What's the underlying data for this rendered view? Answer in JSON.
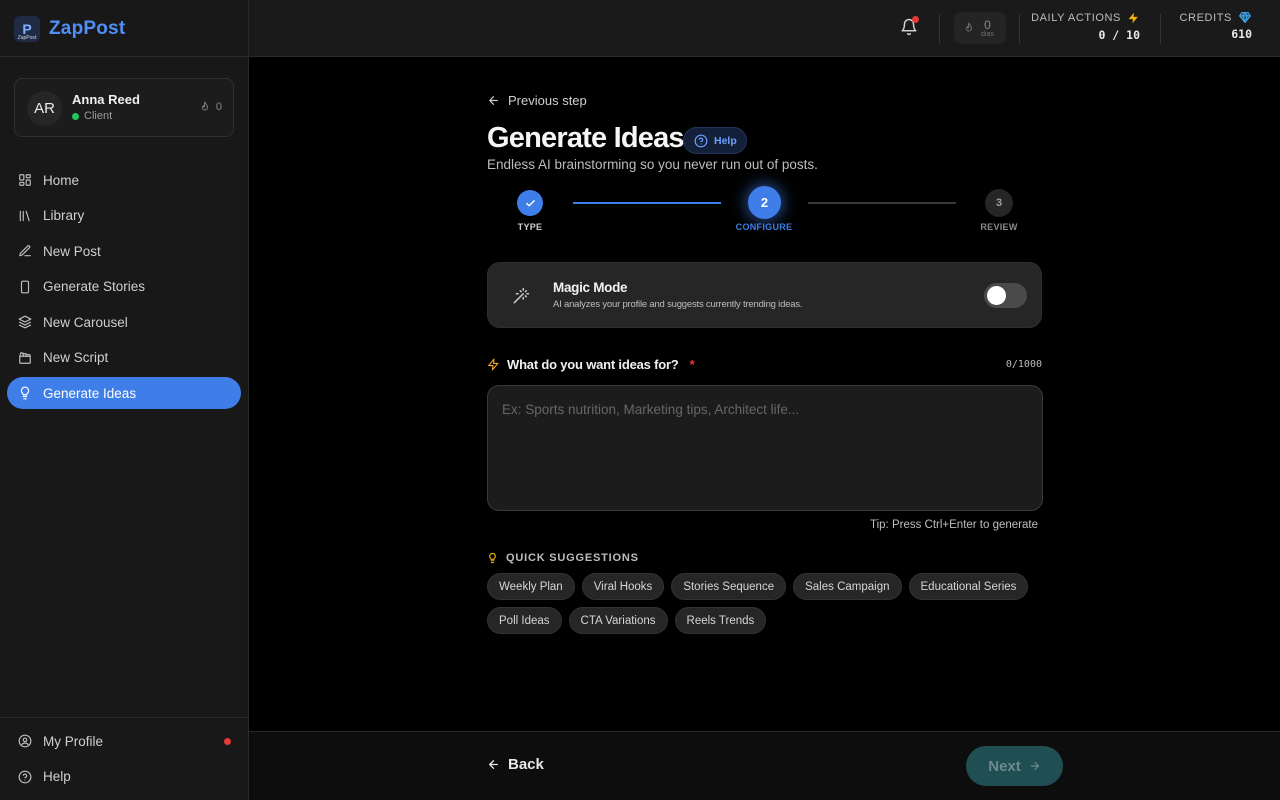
{
  "brand": {
    "name": "ZapPost",
    "logo_letter": "P",
    "logo_subtext": "ZapPost"
  },
  "user": {
    "initials": "AR",
    "name": "Anna Reed",
    "role": "Client",
    "streak": "0"
  },
  "sidebar": {
    "items": [
      {
        "label": "Home",
        "icon": "grid-icon"
      },
      {
        "label": "Library",
        "icon": "library-icon"
      },
      {
        "label": "New Post",
        "icon": "pen-icon"
      },
      {
        "label": "Generate Stories",
        "icon": "phone-icon"
      },
      {
        "label": "New Carousel",
        "icon": "layers-icon"
      },
      {
        "label": "New Script",
        "icon": "clapperboard-icon"
      },
      {
        "label": "Generate Ideas",
        "icon": "lightbulb-icon",
        "active": true
      }
    ],
    "bottom": [
      {
        "label": "My Profile",
        "icon": "user-circle-icon"
      },
      {
        "label": "Help",
        "icon": "help-circle-icon"
      }
    ]
  },
  "header": {
    "streak": {
      "value": "0",
      "unit": "dias"
    },
    "daily_actions": {
      "label": "DAILY ACTIONS",
      "value": "0 / 10"
    },
    "credits": {
      "label": "CREDITS",
      "value": "610"
    }
  },
  "main": {
    "previous_step": "Previous step",
    "title": "Generate Ideas",
    "help": "Help",
    "subtitle": "Endless AI brainstorming so you never run out of posts.",
    "steps": [
      {
        "label": "TYPE",
        "number": "1",
        "state": "done"
      },
      {
        "label": "CONFIGURE",
        "number": "2",
        "state": "active"
      },
      {
        "label": "REVIEW",
        "number": "3",
        "state": "pending"
      }
    ],
    "magic_mode": {
      "title": "Magic Mode",
      "description": "AI analyzes your profile and suggests currently trending ideas.",
      "enabled": false
    },
    "question": {
      "label": "What do you want ideas for?",
      "required_mark": "*",
      "count": "0/1000"
    },
    "input": {
      "value": "",
      "placeholder": "Ex: Sports nutrition, Marketing tips, Architect life..."
    },
    "tip": "Tip: Press Ctrl+Enter to generate",
    "quick_suggestions": {
      "label": "QUICK SUGGESTIONS",
      "items": [
        "Weekly Plan",
        "Viral Hooks",
        "Stories Sequence",
        "Sales Campaign",
        "Educational Series",
        "Poll Ideas",
        "CTA Variations",
        "Reels Trends"
      ]
    }
  },
  "footer": {
    "back": "Back",
    "next": "Next"
  },
  "colors": {
    "accent": "#3f7ee8",
    "brand": "#4f8ff7",
    "next_bg": "#1f4f52",
    "alert": "#e53935",
    "online": "#22c55e"
  }
}
